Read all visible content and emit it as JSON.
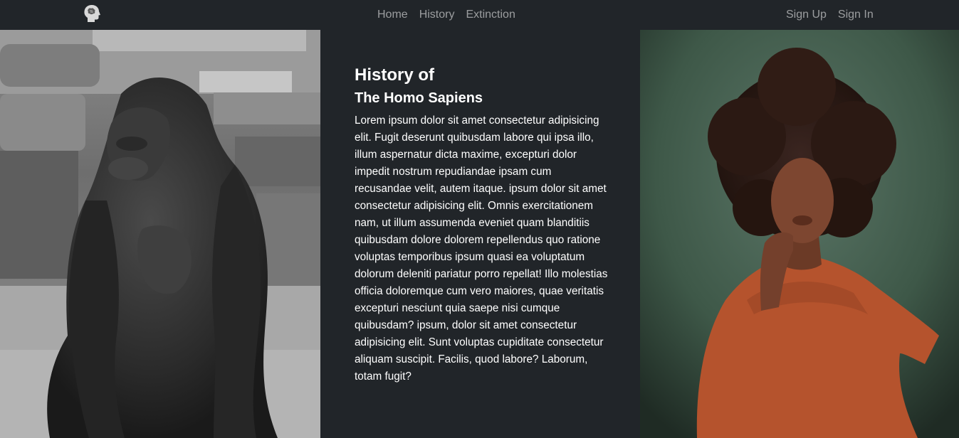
{
  "navbar": {
    "brand_icon": "head-profile-icon",
    "links": [
      {
        "label": "Home"
      },
      {
        "label": "History"
      },
      {
        "label": "Extinction"
      }
    ],
    "auth": [
      {
        "label": "Sign Up"
      },
      {
        "label": "Sign In"
      }
    ]
  },
  "main": {
    "title": "History of",
    "subtitle": "The Homo Sapiens",
    "paragraph": "Lorem ipsum dolor sit amet consectetur adipisicing elit. Fugit deserunt quibusdam labore qui ipsa illo, illum aspernatur dicta maxime, excepturi dolor impedit nostrum repudiandae ipsam cum recusandae velit, autem itaque. ipsum dolor sit amet consectetur adipisicing elit. Omnis exercitationem nam, ut illum assumenda eveniet quam blanditiis quibusdam dolore dolorem repellendus quo ratione voluptas temporibus ipsum quasi ea voluptatum dolorum deleniti pariatur porro repellat! Illo molestias officia doloremque cum vero maiores, quae veritatis excepturi nesciunt quia saepe nisi cumque quibusdam? ipsum, dolor sit amet consectetur adipisicing elit. Sunt voluptas cupiditate consectetur aliquam suscipit. Facilis, quod labore? Laborum, totam fugit?"
  },
  "images": {
    "left": "gorilla-photo",
    "right": "man-portrait-photo"
  },
  "colors": {
    "navbar_bg": "#212529",
    "page_bg": "#212529",
    "nav_link": "#8c8f93",
    "text": "#ffffff"
  }
}
